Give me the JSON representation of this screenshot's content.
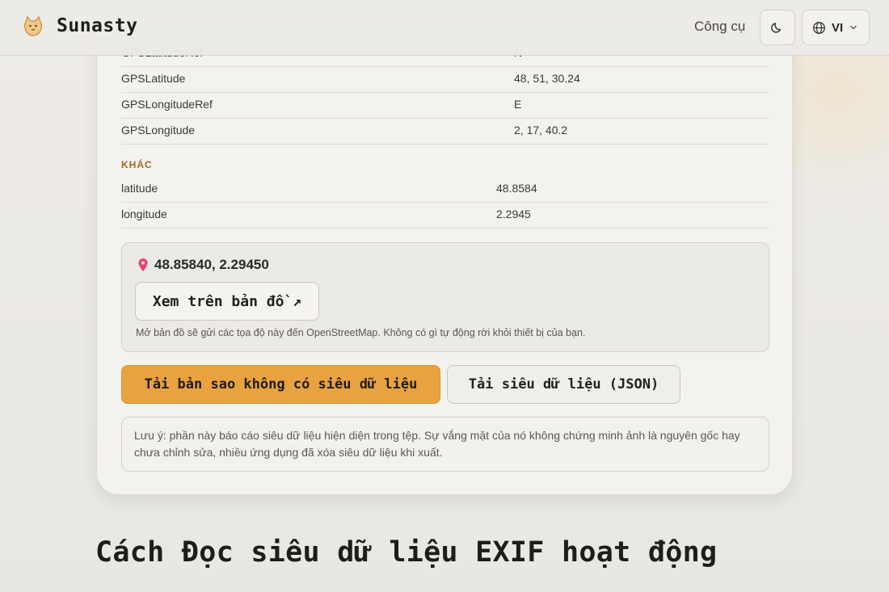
{
  "header": {
    "brand": "Sunasty",
    "nav_tools": "Công cụ",
    "lang": "VI"
  },
  "gps_rows": [
    {
      "key": "GPSLatitudeRef",
      "value": "N"
    },
    {
      "key": "GPSLatitude",
      "value": "48, 51, 30.24"
    },
    {
      "key": "GPSLongitudeRef",
      "value": "E"
    },
    {
      "key": "GPSLongitude",
      "value": "2, 17, 40.2"
    }
  ],
  "other_section": {
    "title": "KHÁC",
    "rows": [
      {
        "key": "latitude",
        "value": "48.8584"
      },
      {
        "key": "longitude",
        "value": "2.2945"
      }
    ]
  },
  "map": {
    "coords": "48.85840, 2.29450",
    "button_label": "Xem trên bản đồ ↗",
    "note": "Mở bản đồ sẽ gửi các tọa độ này đến OpenStreetMap. Không có gì tự động rời khỏi thiết bị của bạn."
  },
  "actions": {
    "download_clean": "Tải bản sao không có siêu dữ liệu",
    "download_json": "Tải siêu dữ liệu (JSON)"
  },
  "disclaimer": "Lưu ý: phần này báo cáo siêu dữ liệu hiện diện trong tệp. Sự vắng mặt của nó không chứng minh ảnh là nguyên gốc hay chưa chỉnh sửa, nhiều ứng dụng đã xóa siêu dữ liệu khi xuất.",
  "section_heading": "Cách Đọc siêu dữ liệu EXIF hoạt động",
  "colors": {
    "accent": "#e8a23f",
    "section_label": "#a8661a",
    "background": "#ebe9e4"
  }
}
